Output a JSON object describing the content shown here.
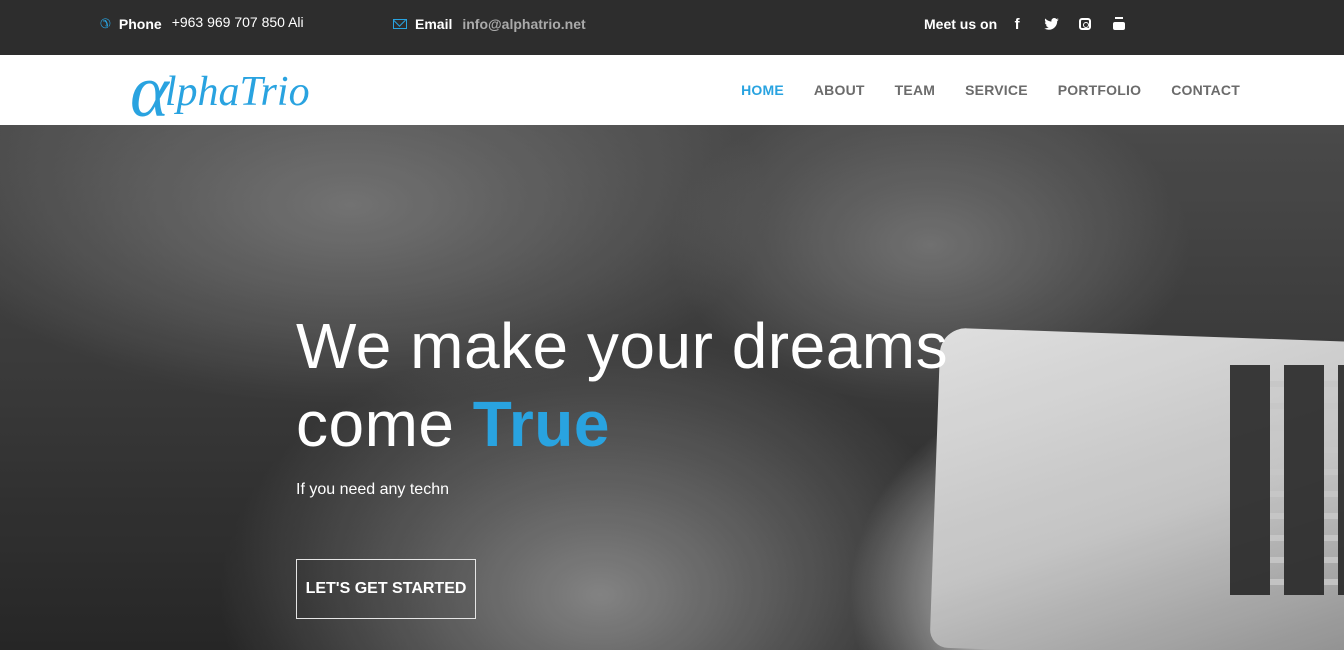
{
  "topbar": {
    "phone_label": "Phone",
    "phone_number": "+963 969 707 850 Ali",
    "email_label": "Email",
    "email_address": "info@alphatrio.net",
    "meet_label": "Meet us on",
    "social_icons": [
      "facebook-icon",
      "twitter-icon",
      "instagram-icon",
      "youtube-icon"
    ]
  },
  "nav": {
    "logo_alpha": "α",
    "logo_text": "lphaTrio",
    "items": [
      {
        "label": "HOME",
        "active": true
      },
      {
        "label": "ABOUT",
        "active": false
      },
      {
        "label": "TEAM",
        "active": false
      },
      {
        "label": "SERVICE",
        "active": false
      },
      {
        "label": "PORTFOLIO",
        "active": false
      },
      {
        "label": "CONTACT",
        "active": false
      }
    ]
  },
  "hero": {
    "headline_line1": "We make your dreams",
    "headline_line2_prefix": "come ",
    "headline_accent": "True",
    "subtitle": "If you need any techn",
    "cta_label": "LET'S GET STARTED"
  },
  "colors": {
    "accent": "#29a3e0",
    "topbar_bg": "#2d2d2d",
    "nav_bg": "#ffffff",
    "nav_text": "#6b6b6b"
  }
}
